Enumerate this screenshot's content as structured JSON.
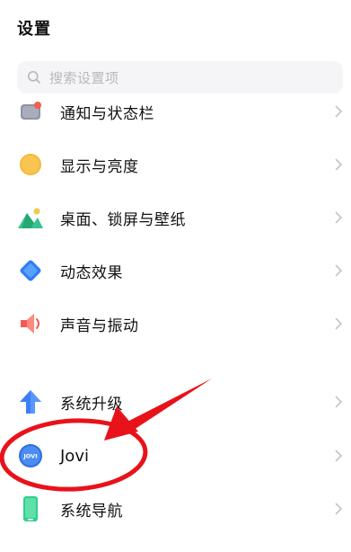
{
  "header": {
    "title": "设置"
  },
  "search": {
    "placeholder": "搜索设置项"
  },
  "items": [
    {
      "label": "通知与状态栏",
      "icon": "notification-icon"
    },
    {
      "label": "显示与亮度",
      "icon": "brightness-icon"
    },
    {
      "label": "桌面、锁屏与壁纸",
      "icon": "wallpaper-icon"
    },
    {
      "label": "动态效果",
      "icon": "dynamic-effect-icon"
    },
    {
      "label": "声音与振动",
      "icon": "sound-icon"
    },
    {
      "label": "系统升级",
      "icon": "system-upgrade-icon"
    },
    {
      "label": "Jovi",
      "icon": "jovi-icon",
      "badge_text": "JOVI"
    },
    {
      "label": "系统导航",
      "icon": "navigation-icon"
    }
  ],
  "colors": {
    "annotation_red": "#e8121b",
    "chevron": "#c4c4c8",
    "upgrade_blue": "#3d7ef5",
    "brightness_orange": "#f6b93b",
    "wallpaper_green": "#35c28e",
    "effect_blue": "#2f7cf6",
    "sound_red": "#f25a5a",
    "nav_green": "#2fcf8a"
  }
}
